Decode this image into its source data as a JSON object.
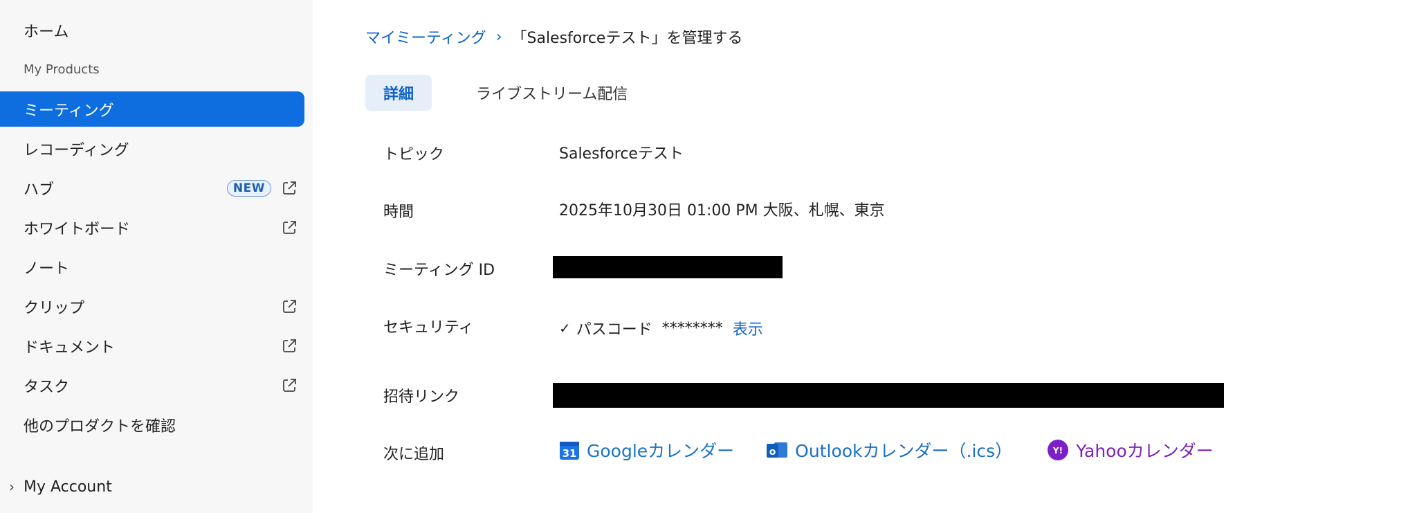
{
  "sidebar": {
    "items": [
      {
        "label": "ホーム"
      },
      {
        "label": "My Products"
      },
      {
        "label": "ミーティング"
      },
      {
        "label": "レコーディング"
      },
      {
        "label": "ハブ",
        "badge": "NEW"
      },
      {
        "label": "ホワイトボード"
      },
      {
        "label": "ノート"
      },
      {
        "label": "クリップ"
      },
      {
        "label": "ドキュメント"
      },
      {
        "label": "タスク"
      },
      {
        "label": "他のプロダクトを確認"
      }
    ],
    "account": {
      "label": "My Account"
    },
    "icons": {
      "external": "external-link-icon",
      "expand": "chevron-right-icon"
    },
    "accent_color": "#0e6ee0"
  },
  "breadcrumb": {
    "parent": "マイミーティング",
    "separator": "›",
    "current": "「Salesforceテスト」を管理する"
  },
  "tabs": [
    {
      "label": "詳細",
      "active": true
    },
    {
      "label": "ライブストリーム配信",
      "active": false
    }
  ],
  "details": {
    "topic": {
      "label": "トピック",
      "value": "Salesforceテスト"
    },
    "time": {
      "label": "時間",
      "value": "2025年10月30日 01:00 PM 大阪、札幌、東京"
    },
    "meeting_id": {
      "label": "ミーティング ID"
    },
    "security": {
      "label": "セキュリティ",
      "check": "✓",
      "passcode_label": "パスコード",
      "passcode_masked": "********",
      "show_link": "表示"
    },
    "invite_link": {
      "label": "招待リンク"
    },
    "add_to": {
      "label": "次に追加",
      "google": "Googleカレンダー",
      "outlook": "Outlookカレンダー（.ics）",
      "yahoo": "Yahooカレンダー",
      "google_icon_text": "31",
      "outlook_icon_text": "o",
      "yahoo_icon_text": "Y!"
    }
  }
}
